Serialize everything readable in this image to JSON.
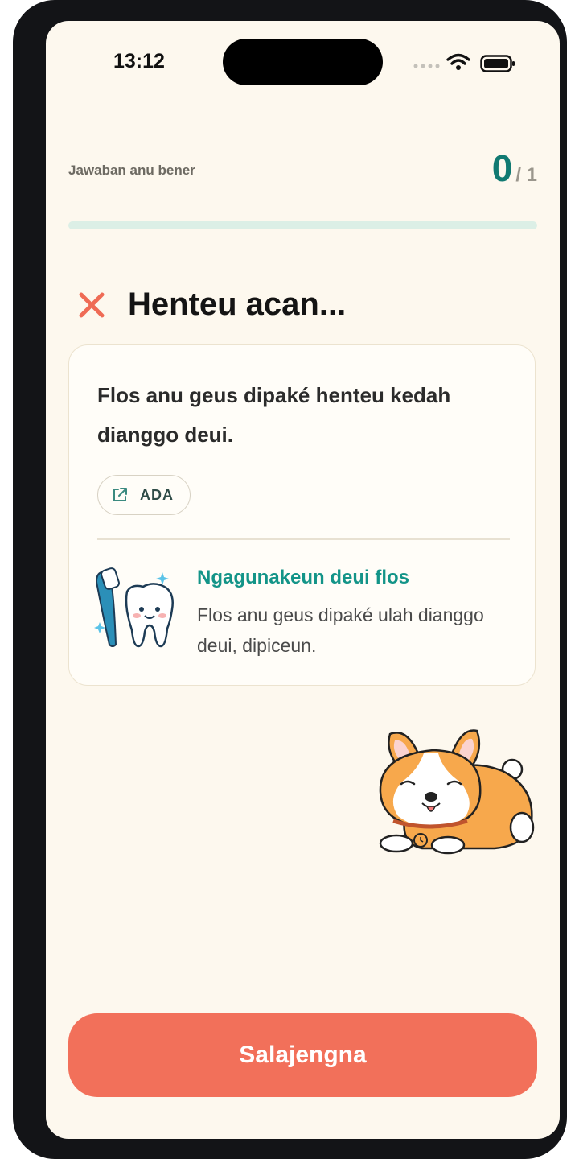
{
  "status_bar": {
    "time": "13:12"
  },
  "score": {
    "label": "Jawaban anu bener",
    "correct": "0",
    "total": "/ 1",
    "progress_fraction": 0.0
  },
  "result": {
    "title": "Henteu acan..."
  },
  "question": {
    "statement": "Flos anu geus dipaké henteu kedah dianggo deui.",
    "answer_label": "ADA"
  },
  "tip": {
    "title": "Ngagunakeun deui flos",
    "body": "Flos anu geus dipaké ulah dianggo deui, dipiceun."
  },
  "next_button": {
    "label": "Salajengna"
  },
  "colors": {
    "accent": "#117a72",
    "danger": "#f2705a",
    "tip_title": "#139488",
    "background": "#fdf8ee"
  },
  "icons": [
    "wrong-x-icon",
    "external-link-icon",
    "toothbrush-tooth-illustration",
    "sleeping-corgi-illustration"
  ]
}
